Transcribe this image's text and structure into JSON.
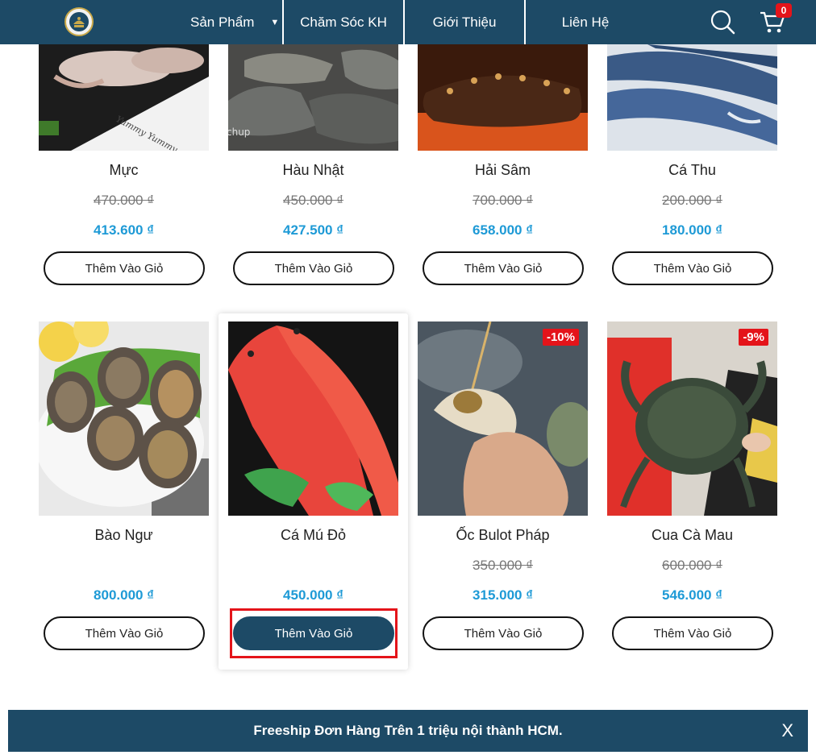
{
  "header": {
    "nav": [
      {
        "label": "Sản Phẩm"
      },
      {
        "label": "Chăm Sóc KH"
      },
      {
        "label": "Giới Thiệu"
      },
      {
        "label": "Liên Hệ"
      }
    ],
    "cart_count": "0"
  },
  "products": [
    {
      "name": "Mực",
      "old_price": "470.000 ₫",
      "price": "413.600 ₫",
      "button": "Thêm Vào Giỏ"
    },
    {
      "name": "Hàu Nhật",
      "old_price": "450.000 ₫",
      "price": "427.500 ₫",
      "button": "Thêm Vào Giỏ"
    },
    {
      "name": "Hải Sâm",
      "old_price": "700.000 ₫",
      "price": "658.000 ₫",
      "button": "Thêm Vào Giỏ"
    },
    {
      "name": "Cá Thu",
      "old_price": "200.000 ₫",
      "price": "180.000 ₫",
      "button": "Thêm Vào Giỏ"
    },
    {
      "name": "Bào Ngư",
      "price": "800.000 ₫",
      "button": "Thêm Vào Giỏ"
    },
    {
      "name": "Cá Mú Đỏ",
      "price": "450.000 ₫",
      "button": "Thêm Vào Giỏ"
    },
    {
      "name": "Ốc Bulot Pháp",
      "old_price": "350.000 ₫",
      "price": "315.000 ₫",
      "button": "Thêm Vào Giỏ",
      "discount": "-10%"
    },
    {
      "name": "Cua Cà Mau",
      "old_price": "600.000 ₫",
      "price": "546.000 ₫",
      "button": "Thêm Vào Giỏ",
      "discount": "-9%"
    }
  ],
  "banner": {
    "text": "Freeship Đơn Hàng Trên 1 triệu nội thành HCM.",
    "close": "X"
  },
  "colors": {
    "header_bg": "#1d4a66",
    "price": "#1e9ad6",
    "discount": "#e4141a"
  }
}
